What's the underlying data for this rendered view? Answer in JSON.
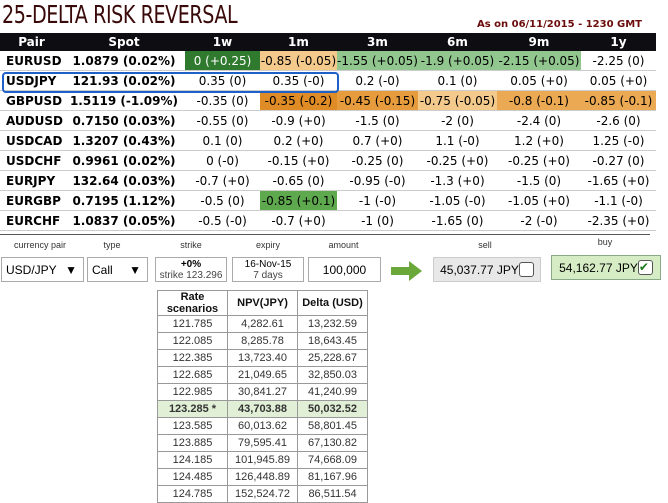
{
  "title": "25-DELTA RISK REVERSAL",
  "as_of": "As on 06/11/2015 - 1230 GMT",
  "columns": [
    "Pair",
    "Spot",
    "1w",
    "1m",
    "3m",
    "6m",
    "9m",
    "1y"
  ],
  "rows": [
    {
      "pair": "EURUSD",
      "spot": "1.0879 (0.02%)",
      "cells": [
        [
          "0 (+0.25)",
          "#2f7a2f",
          "#fff"
        ],
        [
          "-0.85 (-0.05)",
          "#f4c98c"
        ],
        [
          "-1.55 (+0.05)",
          "#92c68f"
        ],
        [
          "-1.9 (+0.05)",
          "#92c68f"
        ],
        [
          "-2.15 (+0.05)",
          "#92c68f"
        ],
        [
          "-2.25 (0)",
          ""
        ]
      ]
    },
    {
      "pair": "USDJPY",
      "spot": "121.93 (0.02%)",
      "cells": [
        [
          "0.35 (0)",
          ""
        ],
        [
          "0.35 (-0)",
          ""
        ],
        [
          "0.2 (-0)",
          ""
        ],
        [
          "0.1 (0)",
          ""
        ],
        [
          "0.05 (+0)",
          ""
        ],
        [
          "0.05 (+0)",
          ""
        ]
      ]
    },
    {
      "pair": "GBPUSD",
      "spot": "1.5119 (-1.09%)",
      "cells": [
        [
          "-0.35 (0)",
          ""
        ],
        [
          "-0.35 (-0.2)",
          "#e08c26"
        ],
        [
          "-0.45 (-0.15)",
          "#e69b3c"
        ],
        [
          "-0.75 (-0.05)",
          "#f4c98c"
        ],
        [
          "-0.8 (-0.1)",
          "#eca953"
        ],
        [
          "-0.85 (-0.1)",
          "#eca953"
        ]
      ]
    },
    {
      "pair": "AUDUSD",
      "spot": "0.7150 (0.03%)",
      "cells": [
        [
          "-0.55 (0)",
          ""
        ],
        [
          "-0.9 (+0)",
          ""
        ],
        [
          "-1.5 (0)",
          ""
        ],
        [
          "-2 (0)",
          ""
        ],
        [
          "-2.4 (0)",
          ""
        ],
        [
          "-2.6 (0)",
          ""
        ]
      ]
    },
    {
      "pair": "USDCAD",
      "spot": "1.3207 (0.43%)",
      "cells": [
        [
          "0.1 (0)",
          ""
        ],
        [
          "0.2 (+0)",
          ""
        ],
        [
          "0.7 (+0)",
          ""
        ],
        [
          "1.1 (-0)",
          ""
        ],
        [
          "1.2 (+0)",
          ""
        ],
        [
          "1.25 (-0)",
          ""
        ]
      ]
    },
    {
      "pair": "USDCHF",
      "spot": "0.9961 (0.02%)",
      "cells": [
        [
          "0 (-0)",
          ""
        ],
        [
          "-0.15 (+0)",
          ""
        ],
        [
          "-0.25 (0)",
          ""
        ],
        [
          "-0.25 (+0)",
          ""
        ],
        [
          "-0.25 (+0)",
          ""
        ],
        [
          "-0.27 (0)",
          ""
        ]
      ]
    },
    {
      "pair": "EURJPY",
      "spot": "132.64 (0.03%)",
      "cells": [
        [
          "-0.7 (+0)",
          ""
        ],
        [
          "-0.65 (0)",
          ""
        ],
        [
          "-0.95 (-0)",
          ""
        ],
        [
          "-1.3 (+0)",
          ""
        ],
        [
          "-1.5 (0)",
          ""
        ],
        [
          "-1.65 (+0)",
          ""
        ]
      ]
    },
    {
      "pair": "EURGBP",
      "spot": "0.7195 (1.12%)",
      "cells": [
        [
          "-0.5 (0)",
          ""
        ],
        [
          "-0.85 (+0.1)",
          "#5ea94e"
        ],
        [
          "-1 (-0)",
          ""
        ],
        [
          "-1.05 (-0)",
          ""
        ],
        [
          "-1.05 (+0)",
          ""
        ],
        [
          "-1.1 (-0)",
          ""
        ]
      ]
    },
    {
      "pair": "EURCHF",
      "spot": "1.0837 (0.05%)",
      "cells": [
        [
          "-0.5 (-0)",
          ""
        ],
        [
          "-0.7 (+0)",
          ""
        ],
        [
          "-1 (0)",
          ""
        ],
        [
          "-1.65 (0)",
          ""
        ],
        [
          "-2 (-0)",
          ""
        ],
        [
          "-2.35 (+0)",
          ""
        ]
      ]
    }
  ],
  "form": {
    "labels": {
      "pair": "currency pair",
      "type": "type",
      "strike": "strike",
      "expiry": "expiry",
      "amount": "amount",
      "sell": "sell",
      "buy": "buy"
    },
    "pair": "USD/JPY",
    "type": "Call",
    "strike_pct": "+0%",
    "strike_val": "strike 123.296",
    "expiry_date": "16-Nov-15",
    "expiry_days": "7 days",
    "amount": "100,000",
    "sell": "45,037.77 JPY",
    "buy": "54,162.77 JPY"
  },
  "scenarios": {
    "headers": [
      "Rate scenarios",
      "NPV(JPY)",
      "Delta (USD)"
    ],
    "rows": [
      [
        "121.785",
        "4,282.61",
        "13,232.59"
      ],
      [
        "122.085",
        "8,285.78",
        "18,643.45"
      ],
      [
        "122.385",
        "13,723.40",
        "25,228.67"
      ],
      [
        "122.685",
        "21,049.65",
        "32,850.03"
      ],
      [
        "122.985",
        "30,841.27",
        "41,240.99"
      ],
      [
        "123.285 *",
        "43,703.88",
        "50,032.52"
      ],
      [
        "123.585",
        "60,013.62",
        "58,801.45"
      ],
      [
        "123.885",
        "79,595.41",
        "67,130.82"
      ],
      [
        "124.185",
        "101,945.89",
        "74,668.09"
      ],
      [
        "124.485",
        "126,448.89",
        "81,167.96"
      ],
      [
        "124.785",
        "152,524.72",
        "86,511.54"
      ]
    ],
    "current_index": 5
  }
}
